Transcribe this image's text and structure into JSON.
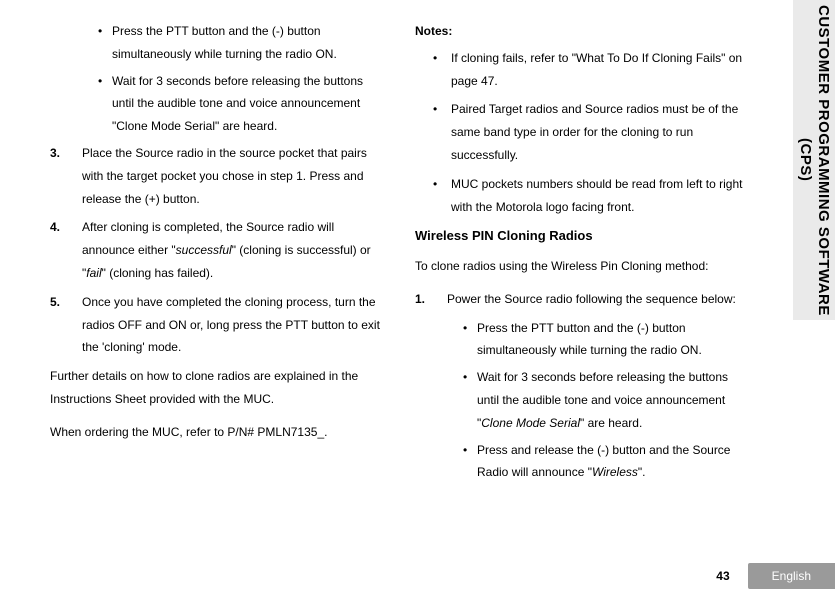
{
  "sidebar": {
    "title": "CUSTOMER PROGRAMMING SOFTWARE (CPS)"
  },
  "footer": {
    "page": "43",
    "lang": "English"
  },
  "col1": {
    "b1": "Press the PTT button and the (-) button simultaneously while turning the radio ON.",
    "b2": "Wait for 3 seconds before releasing the buttons until the audible tone and voice announcement \"Clone Mode Serial\" are heard.",
    "n3": "3.",
    "t3": "Place the Source radio in the source pocket that pairs with the target pocket you chose in step 1. Press and release the (+) button.",
    "n4": "4.",
    "t4a": "After cloning is completed, the Source radio will announce either \"",
    "t4b": "successful",
    "t4c": "\" (cloning is successful) or \"",
    "t4d": "fail",
    "t4e": "\" (cloning has failed).",
    "n5": "5.",
    "t5": "Once you have completed the cloning process, turn the radios OFF and ON or, long press the PTT button to exit the 'cloning' mode.",
    "p1": "Further details on how to clone radios are explained in the Instructions Sheet provided with the MUC.",
    "p2": "When ordering the MUC, refer to P/N# PMLN7135_."
  },
  "col2": {
    "notesH": "Notes:",
    "note1": "If cloning fails, refer to \"What To Do If Cloning Fails\" on page 47.",
    "note2": "Paired Target radios and Source radios must be of the same band type in order for the cloning to run successfully.",
    "note3": "MUC pockets numbers should be read from left to right with the Motorola logo facing front.",
    "h": "Wireless PIN Cloning Radios",
    "intro": "To clone radios using the Wireless Pin Cloning method:",
    "n1": "1.",
    "t1": "Power the Source radio following the sequence below:",
    "b1": "Press the PTT button and the (-) button simultaneously while turning the radio ON.",
    "b2a": "Wait for 3 seconds before releasing the buttons until the audible tone and voice announcement \"",
    "b2b": "Clone Mode Serial",
    "b2c": "\" are heard.",
    "b3a": "Press and release the (-) button and the Source Radio will announce \"",
    "b3b": "Wireless",
    "b3c": "\"."
  }
}
